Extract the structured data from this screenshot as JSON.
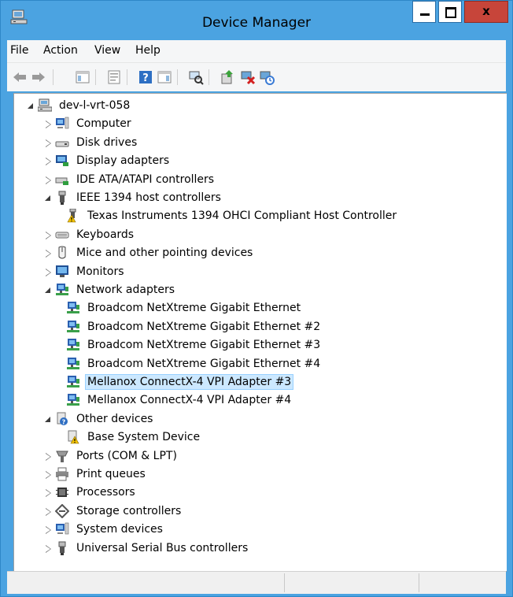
{
  "window": {
    "title": "Device Manager"
  },
  "menu": [
    "File",
    "Action",
    "View",
    "Help"
  ],
  "toolbar": {
    "buttons": [
      "back-icon",
      "forward-icon",
      "properties-pane-icon",
      "show-hide-icon",
      "help-icon",
      "console-tree-icon",
      "scan-hardware-icon",
      "update-driver-icon",
      "uninstall-device-icon",
      "disable-device-icon"
    ]
  },
  "tree": {
    "root": "dev-l-vrt-058",
    "items": [
      {
        "label": "Computer",
        "state": "collapsed",
        "icon": "computer-icon"
      },
      {
        "label": "Disk drives",
        "state": "collapsed",
        "icon": "disk-drive-icon"
      },
      {
        "label": "Display adapters",
        "state": "collapsed",
        "icon": "display-adapter-icon"
      },
      {
        "label": "IDE ATA/ATAPI controllers",
        "state": "collapsed",
        "icon": "ide-controller-icon"
      },
      {
        "label": "IEEE 1394 host controllers",
        "state": "expanded",
        "icon": "ieee1394-icon"
      },
      {
        "label": "Texas Instruments 1394 OHCI Compliant Host Controller",
        "child": true,
        "icon": "ieee1394-warning-icon"
      },
      {
        "label": "Keyboards",
        "state": "collapsed",
        "icon": "keyboard-icon"
      },
      {
        "label": "Mice and other pointing devices",
        "state": "collapsed",
        "icon": "mouse-icon"
      },
      {
        "label": "Monitors",
        "state": "collapsed",
        "icon": "monitor-icon"
      },
      {
        "label": "Network adapters",
        "state": "expanded",
        "icon": "network-adapter-icon"
      },
      {
        "label": "Broadcom NetXtreme Gigabit Ethernet",
        "child": true,
        "icon": "network-adapter-icon"
      },
      {
        "label": "Broadcom NetXtreme Gigabit Ethernet #2",
        "child": true,
        "icon": "network-adapter-icon"
      },
      {
        "label": "Broadcom NetXtreme Gigabit Ethernet #3",
        "child": true,
        "icon": "network-adapter-icon"
      },
      {
        "label": "Broadcom NetXtreme Gigabit Ethernet #4",
        "child": true,
        "icon": "network-adapter-icon"
      },
      {
        "label": "Mellanox ConnectX-4 VPI Adapter #3",
        "child": true,
        "selected": true,
        "icon": "network-adapter-icon"
      },
      {
        "label": "Mellanox ConnectX-4 VPI Adapter #4",
        "child": true,
        "icon": "network-adapter-icon"
      },
      {
        "label": "Other devices",
        "state": "expanded",
        "icon": "unknown-device-icon"
      },
      {
        "label": "Base System Device",
        "child": true,
        "icon": "unknown-device-warning-icon"
      },
      {
        "label": "Ports (COM & LPT)",
        "state": "collapsed",
        "icon": "port-icon"
      },
      {
        "label": "Print queues",
        "state": "collapsed",
        "icon": "printer-icon"
      },
      {
        "label": "Processors",
        "state": "collapsed",
        "icon": "processor-icon"
      },
      {
        "label": "Storage controllers",
        "state": "collapsed",
        "icon": "storage-controller-icon"
      },
      {
        "label": "System devices",
        "state": "collapsed",
        "icon": "system-devices-icon"
      },
      {
        "label": "Universal Serial Bus controllers",
        "state": "collapsed",
        "icon": "usb-icon"
      }
    ]
  },
  "colors": {
    "titlebar": "#4ba3e1",
    "close": "#c7453a",
    "selection": "#cce8ff"
  }
}
